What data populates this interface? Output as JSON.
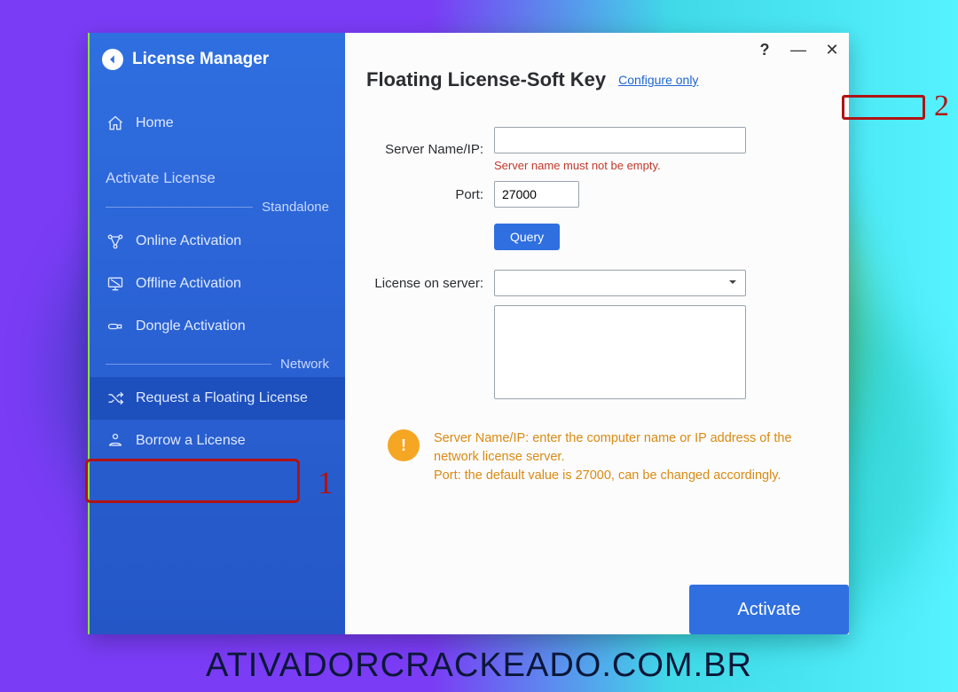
{
  "window": {
    "title": "License Manager",
    "controls": {
      "help": "?",
      "minimize": "—",
      "close": "✕"
    }
  },
  "sidebar": {
    "home": "Home",
    "activate_section": "Activate License",
    "divider_standalone": "Standalone",
    "items_standalone": [
      {
        "label": "Online Activation"
      },
      {
        "label": "Offline Activation"
      },
      {
        "label": "Dongle Activation"
      }
    ],
    "divider_network": "Network",
    "items_network": [
      {
        "label": "Request a Floating License",
        "selected": true
      },
      {
        "label": "Borrow a License"
      }
    ]
  },
  "main": {
    "heading": "Floating License-Soft Key",
    "configure_link": "Configure only",
    "server_label": "Server Name/IP:",
    "server_value": "",
    "server_validation": "Server name must not be empty.",
    "port_label": "Port:",
    "port_value": "27000",
    "query_button": "Query",
    "license_label": "License on server:",
    "license_selected": "",
    "hint_line1": "Server Name/IP: enter the computer name or IP address of the network license server.",
    "hint_line2": "Port: the default value is 27000, can be changed accordingly.",
    "activate_button": "Activate"
  },
  "annotations": {
    "one": "1",
    "two": "2"
  },
  "watermark": "ATIVADORCRACKEADO.COM.BR"
}
